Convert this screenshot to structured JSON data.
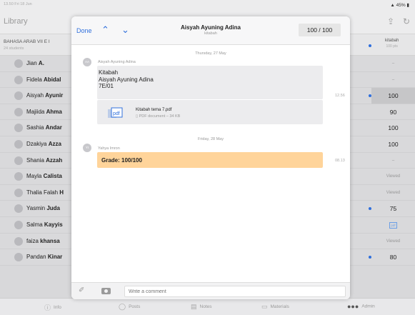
{
  "statusbar": {
    "time": "13.50  Fri 18 Jun",
    "battery": "45%"
  },
  "nav": {
    "library": "Library"
  },
  "class": {
    "name": "BAHASA ARAB VII E I",
    "count": "24 students",
    "column_title": "kitabah",
    "column_points": "100 pts"
  },
  "students": [
    {
      "first": "Jian",
      "last": "A.",
      "score": "–",
      "dot": false,
      "highlight": false
    },
    {
      "first": "Fidela",
      "last": "Abidal",
      "score": "–",
      "dot": false,
      "highlight": false
    },
    {
      "first": "Aisyah",
      "last": "Ayunir",
      "score": "100",
      "dot": true,
      "highlight": true
    },
    {
      "first": "Majiida",
      "last": "Ahma",
      "score": "90",
      "dot": false,
      "highlight": false
    },
    {
      "first": "Sashia",
      "last": "Andar",
      "score": "100",
      "dot": false,
      "highlight": false
    },
    {
      "first": "Dzakiya",
      "last": "Azza",
      "score": "100",
      "dot": false,
      "highlight": false
    },
    {
      "first": "Shania",
      "last": "Azzah",
      "score": "–",
      "dot": false,
      "highlight": false
    },
    {
      "first": "Mayla",
      "last": "Calista",
      "score": "Viewed",
      "dot": false,
      "highlight": false
    },
    {
      "first": "Thalia Falah",
      "last": "H",
      "score": "Viewed",
      "dot": false,
      "highlight": false
    },
    {
      "first": "Yasmin",
      "last": "Juda",
      "score": "75",
      "dot": true,
      "highlight": false
    },
    {
      "first": "Salma",
      "last": "Kayyis",
      "score": "pdf",
      "dot": false,
      "highlight": false
    },
    {
      "first": "faiza",
      "last": "khansa",
      "score": "Viewed",
      "dot": false,
      "highlight": false
    },
    {
      "first": "Pandan",
      "last": "Kinar",
      "score": "80",
      "dot": true,
      "highlight": false
    }
  ],
  "tabs": {
    "info": "Info",
    "posts": "Posts",
    "notes": "Notes",
    "materials": "Materials",
    "admin": "Admin"
  },
  "modal": {
    "done": "Done",
    "title": "Aisyah Ayuning Adina",
    "subtitle": "kitabah",
    "grade": "100 / 100",
    "date1": "Thursday, 27 May",
    "sender1_initials": "AA",
    "sender1": "Aisyah Ayuning Adina",
    "message_line1": "Kitabah",
    "message_line2": "Aisyah Ayuning Adina",
    "message_line3": "7E/01",
    "time1": "12.56",
    "file_name": "Kitabah tema 7.pdf",
    "file_meta": "PDF document – 34 KB",
    "date2": "Friday, 28 May",
    "sender2_initials": "YI",
    "sender2": "Yahya Imron",
    "grade_message": "Grade: 100/100",
    "time2": "08.13",
    "comment_placeholder": "Write a comment"
  }
}
